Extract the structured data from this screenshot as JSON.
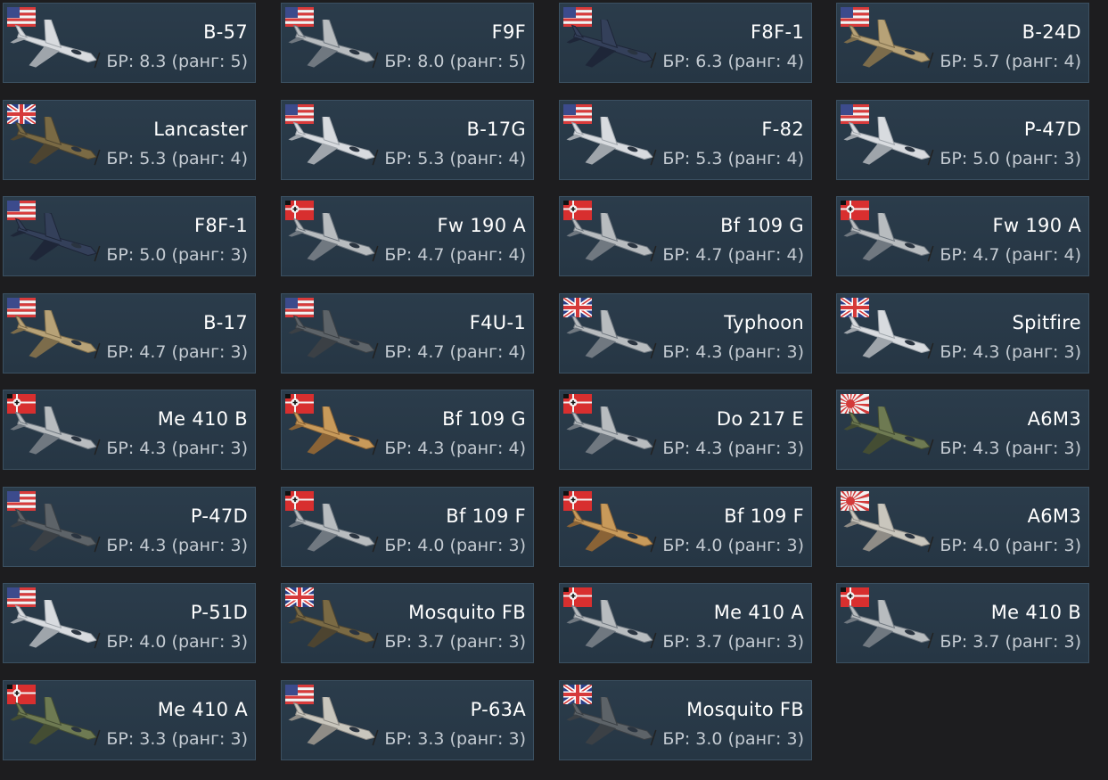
{
  "cards": [
    {
      "name": "B-57",
      "br": "БР: 8.3 (ранг: 5)",
      "nation": "usa",
      "camo": "silver"
    },
    {
      "name": "F9F",
      "br": "БР: 8.0 (ранг: 5)",
      "nation": "usa",
      "camo": "gray"
    },
    {
      "name": "F8F-1",
      "br": "БР: 6.3 (ранг: 4)",
      "nation": "usa",
      "camo": "navy"
    },
    {
      "name": "B-24D",
      "br": "БР: 5.7 (ранг: 4)",
      "nation": "usa",
      "camo": "khaki"
    },
    {
      "name": "Lancaster",
      "br": "БР: 5.3 (ранг: 4)",
      "nation": "uk",
      "camo": "camo-brown"
    },
    {
      "name": "B-17G",
      "br": "БР: 5.3 (ранг: 4)",
      "nation": "usa",
      "camo": "silver"
    },
    {
      "name": "F-82",
      "br": "БР: 5.3 (ранг: 4)",
      "nation": "usa",
      "camo": "silver"
    },
    {
      "name": "P-47D",
      "br": "БР: 5.0 (ранг: 3)",
      "nation": "usa",
      "camo": "silver"
    },
    {
      "name": "F8F-1",
      "br": "БР: 5.0 (ранг: 3)",
      "nation": "usa",
      "camo": "navy"
    },
    {
      "name": "Fw 190 A",
      "br": "БР: 4.7 (ранг: 4)",
      "nation": "germany",
      "camo": "gray"
    },
    {
      "name": "Bf 109 G",
      "br": "БР: 4.7 (ранг: 4)",
      "nation": "germany",
      "camo": "gray"
    },
    {
      "name": "Fw 190 A",
      "br": "БР: 4.7 (ранг: 4)",
      "nation": "germany",
      "camo": "gray"
    },
    {
      "name": "B-17",
      "br": "БР: 4.7 (ранг: 3)",
      "nation": "usa",
      "camo": "khaki"
    },
    {
      "name": "F4U-1",
      "br": "БР: 4.7 (ранг: 4)",
      "nation": "usa",
      "camo": "dark-gray"
    },
    {
      "name": "Typhoon",
      "br": "БР: 4.3 (ранг: 3)",
      "nation": "uk",
      "camo": "gray"
    },
    {
      "name": "Spitfire",
      "br": "БР: 4.3 (ранг: 3)",
      "nation": "uk",
      "camo": "silver"
    },
    {
      "name": "Me 410 B",
      "br": "БР: 4.3 (ранг: 3)",
      "nation": "germany",
      "camo": "gray"
    },
    {
      "name": "Bf 109 G",
      "br": "БР: 4.3 (ранг: 4)",
      "nation": "germany",
      "camo": "tan"
    },
    {
      "name": "Do 217 E",
      "br": "БР: 4.3 (ранг: 3)",
      "nation": "germany",
      "camo": "gray"
    },
    {
      "name": "A6M3",
      "br": "БР: 4.3 (ранг: 3)",
      "nation": "japan",
      "camo": "green"
    },
    {
      "name": "P-47D",
      "br": "БР: 4.3 (ранг: 3)",
      "nation": "usa",
      "camo": "dark-gray"
    },
    {
      "name": "Bf 109 F",
      "br": "БР: 4.0 (ранг: 3)",
      "nation": "germany",
      "camo": "gray"
    },
    {
      "name": "Bf 109 F",
      "br": "БР: 4.0 (ранг: 3)",
      "nation": "germany",
      "camo": "tan"
    },
    {
      "name": "A6M3",
      "br": "БР: 4.0 (ранг: 3)",
      "nation": "japan",
      "camo": "light-gray"
    },
    {
      "name": "P-51D",
      "br": "БР: 4.0 (ранг: 3)",
      "nation": "usa",
      "camo": "silver"
    },
    {
      "name": "Mosquito FB",
      "br": "БР: 3.7 (ранг: 3)",
      "nation": "uk",
      "camo": "camo-brown"
    },
    {
      "name": "Me 410 A",
      "br": "БР: 3.7 (ранг: 3)",
      "nation": "germany",
      "camo": "gray"
    },
    {
      "name": "Me 410 B",
      "br": "БР: 3.7 (ранг: 3)",
      "nation": "germany",
      "camo": "gray"
    },
    {
      "name": "Me 410 A",
      "br": "БР: 3.3 (ранг: 3)",
      "nation": "germany",
      "camo": "green"
    },
    {
      "name": "P-63A",
      "br": "БР: 3.3 (ранг: 3)",
      "nation": "usa",
      "camo": "light-gray"
    },
    {
      "name": "Mosquito FB",
      "br": "БР: 3.0 (ранг: 3)",
      "nation": "uk",
      "camo": "dark-gray"
    }
  ],
  "colors": {
    "background": "#1d1d1f",
    "card": "#2b3c4b",
    "card_border": "#3b5061",
    "name_text": "#ffffff",
    "br_text": "#c4cbd2"
  }
}
